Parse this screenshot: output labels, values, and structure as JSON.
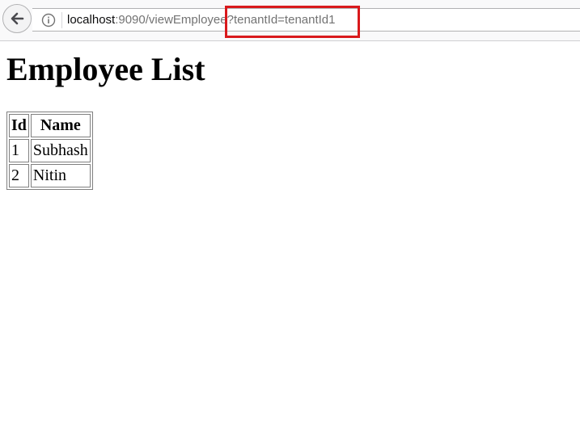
{
  "browser": {
    "url": {
      "host": "localhost",
      "rest": ":9090/viewEmployee?tenantId=tenantId1"
    },
    "highlight_color": "#d9191c"
  },
  "page": {
    "title": "Employee List",
    "table": {
      "headers": [
        "Id",
        "Name"
      ],
      "rows": [
        {
          "id": "1",
          "name": "Subhash"
        },
        {
          "id": "2",
          "name": "Nitin"
        }
      ]
    }
  }
}
